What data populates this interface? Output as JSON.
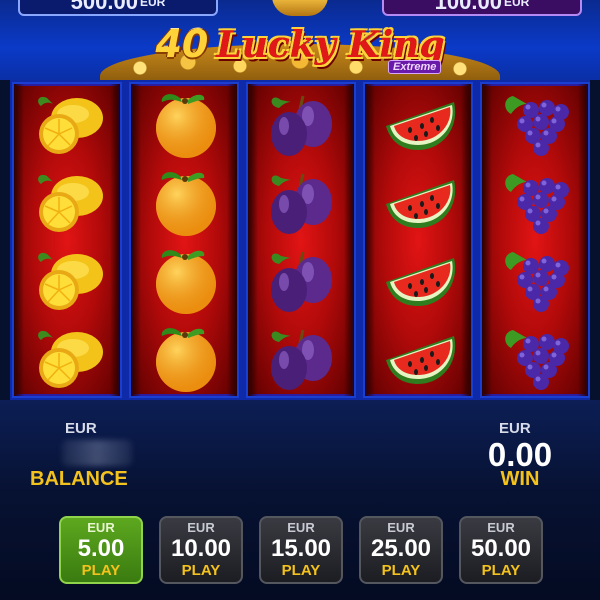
{
  "header": {
    "jackpot_left": {
      "amount": "500.00",
      "currency": "EUR"
    },
    "jackpot_right": {
      "amount": "100.00",
      "currency": "EUR"
    },
    "logo_number": "40",
    "logo_word": "Lucky King",
    "logo_subtitle": "Extreme"
  },
  "reels": [
    {
      "symbol": "lemon",
      "icons": [
        "lemon-icon",
        "lemon-icon",
        "lemon-icon",
        "lemon-icon"
      ]
    },
    {
      "symbol": "orange",
      "icons": [
        "orange-icon",
        "orange-icon",
        "orange-icon",
        "orange-icon"
      ]
    },
    {
      "symbol": "plum",
      "icons": [
        "plum-icon",
        "plum-icon",
        "plum-icon",
        "plum-icon"
      ]
    },
    {
      "symbol": "watermelon",
      "icons": [
        "watermelon-icon",
        "watermelon-icon",
        "watermelon-icon",
        "watermelon-icon"
      ]
    },
    {
      "symbol": "grapes",
      "icons": [
        "grapes-icon",
        "grapes-icon",
        "grapes-icon",
        "grapes-icon"
      ]
    }
  ],
  "panel": {
    "balance": {
      "currency": "EUR",
      "label": "BALANCE"
    },
    "win": {
      "currency": "EUR",
      "value": "0.00",
      "label": "WIN"
    },
    "bets": [
      {
        "currency": "EUR",
        "amount": "5.00",
        "action": "PLAY",
        "selected": true
      },
      {
        "currency": "EUR",
        "amount": "10.00",
        "action": "PLAY",
        "selected": false
      },
      {
        "currency": "EUR",
        "amount": "15.00",
        "action": "PLAY",
        "selected": false
      },
      {
        "currency": "EUR",
        "amount": "25.00",
        "action": "PLAY",
        "selected": false
      },
      {
        "currency": "EUR",
        "amount": "50.00",
        "action": "PLAY",
        "selected": false
      }
    ]
  },
  "colors": {
    "accent_gold": "#f4c21c",
    "reel_red": "#c40e0e",
    "frame_blue": "#0f2aa8",
    "active_button_green": "#4c9418"
  }
}
